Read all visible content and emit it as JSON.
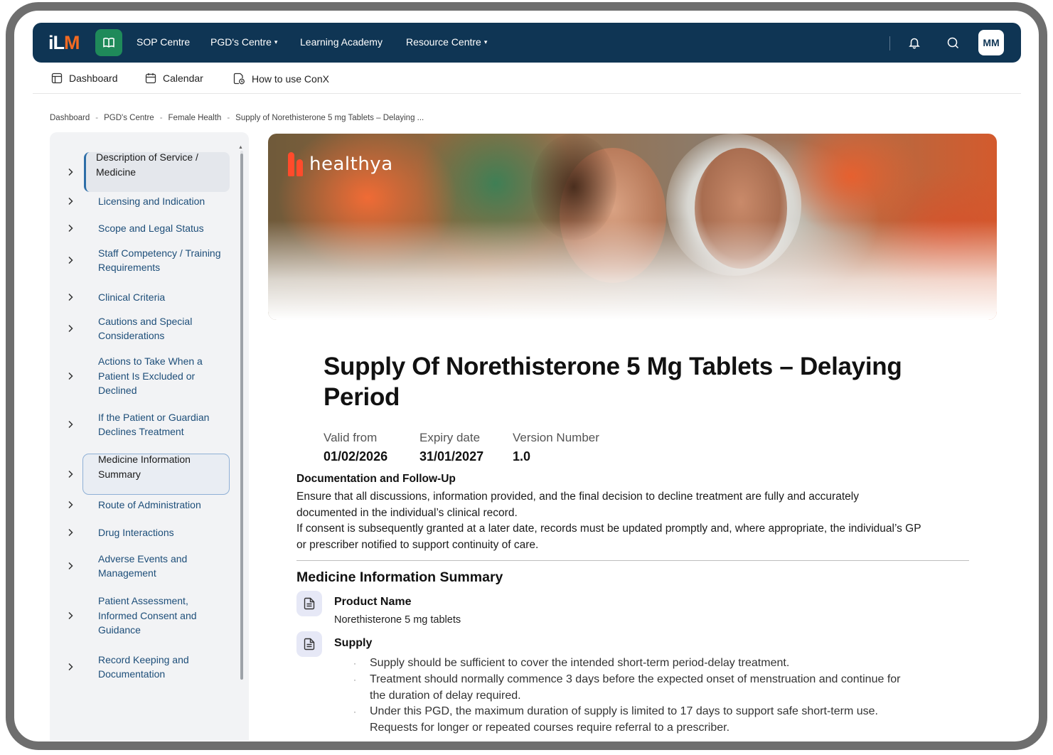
{
  "brand": {
    "logo_text_a": "iL",
    "logo_text_b": "M"
  },
  "topnav": {
    "items": [
      {
        "label": "SOP Centre",
        "has_caret": false
      },
      {
        "label": "PGD's Centre",
        "has_caret": true
      },
      {
        "label": "Learning Academy",
        "has_caret": false
      },
      {
        "label": "Resource Centre",
        "has_caret": true
      }
    ],
    "caret": "▾",
    "avatar_initials": "MM",
    "icons": [
      "book-icon",
      "bell-icon",
      "chat-icon"
    ]
  },
  "subnav": {
    "items": [
      {
        "label": "Dashboard",
        "icon": "dashboard-icon"
      },
      {
        "label": "Calendar",
        "icon": "calendar-icon"
      },
      {
        "label": "How to use ConX",
        "icon": "document-clock-icon"
      }
    ]
  },
  "breadcrumb": {
    "items": [
      "Dashboard",
      "PGD's Centre",
      "Female Health",
      "Supply of Norethisterone 5 mg Tablets – Delaying ..."
    ],
    "separator": "-"
  },
  "sidebar": {
    "items": [
      {
        "label": "Description of Service / Medicine",
        "state": "active"
      },
      {
        "label": "Licensing and Indication",
        "state": "normal"
      },
      {
        "label": "Scope and Legal Status",
        "state": "normal"
      },
      {
        "label": "Staff Competency / Training Requirements",
        "state": "normal"
      },
      {
        "label": "Clinical Criteria",
        "state": "normal"
      },
      {
        "label": "Cautions and Special Considerations",
        "state": "normal"
      },
      {
        "label": "Actions to Take When a Patient Is Excluded or Declined",
        "state": "normal"
      },
      {
        "label": "If the Patient or Guardian Declines Treatment",
        "state": "normal"
      },
      {
        "label": "Medicine Information Summary",
        "state": "focused"
      },
      {
        "label": "Route of Administration",
        "state": "normal"
      },
      {
        "label": "Drug Interactions",
        "state": "normal"
      },
      {
        "label": "Adverse Events and Management",
        "state": "normal"
      },
      {
        "label": "Patient Assessment, Informed Consent and Guidance",
        "state": "normal"
      },
      {
        "label": "Record Keeping and Documentation",
        "state": "normal"
      }
    ]
  },
  "hero": {
    "brand_word": "healthya"
  },
  "page": {
    "title": "Supply Of Norethisterone 5 Mg Tablets – Delaying Period",
    "meta": [
      {
        "label": "Valid from",
        "value": "01/02/2026"
      },
      {
        "label": "Expiry date",
        "value": "31/01/2027"
      },
      {
        "label": "Version Number",
        "value": "1.0"
      }
    ],
    "documentation": {
      "heading": "Documentation and Follow-Up",
      "paragraphs": [
        "Ensure that all discussions, information provided, and the final decision to decline treatment are fully and accurately documented in the individual’s clinical record.",
        "If consent is subsequently granted at a later date, records must be updated promptly and, where appropriate, the individual’s GP or prescriber notified to support continuity of care."
      ]
    },
    "medicine_summary": {
      "heading": "Medicine Information Summary",
      "product_name_label": "Product Name",
      "product_name_value": "Norethisterone 5 mg tablets",
      "supply_label": "Supply",
      "supply_bullets": [
        "Supply should be sufficient to cover the intended short-term period-delay treatment.",
        "Treatment should normally commence 3 days before the expected onset of menstruation and continue for the duration of delay required.",
        "Under this PGD, the maximum duration of supply is limited to 17 days to support safe short-term use. Requests for longer or repeated courses require referral to a prescriber."
      ],
      "bullet_glyph": "·"
    }
  },
  "colors": {
    "nav_bg": "#0f3554",
    "accent_green": "#1f8a5a",
    "link_blue": "#1d4e79",
    "logo_orange": "#f26a22",
    "hero_brand": "#ff4b2b"
  }
}
